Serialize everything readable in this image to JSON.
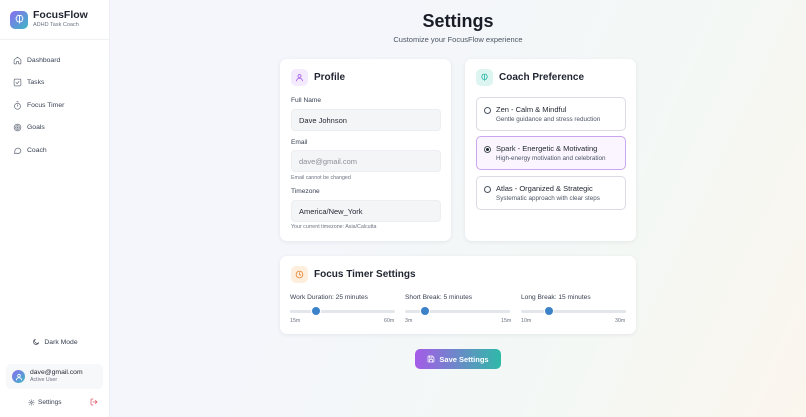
{
  "app": {
    "name": "FocusFlow",
    "tagline": "ADHD Task Coach"
  },
  "sidebar": {
    "items": [
      {
        "label": "Dashboard",
        "icon": "home-icon"
      },
      {
        "label": "Tasks",
        "icon": "check-square-icon"
      },
      {
        "label": "Focus Timer",
        "icon": "timer-icon"
      },
      {
        "label": "Goals",
        "icon": "target-icon"
      },
      {
        "label": "Coach",
        "icon": "chat-icon"
      }
    ],
    "dark_mode_label": "Dark Mode",
    "user": {
      "email": "dave@gmail.com",
      "role": "Active User"
    },
    "settings_label": "Settings"
  },
  "page": {
    "title": "Settings",
    "subtitle": "Customize your FocusFlow experience"
  },
  "profile": {
    "title": "Profile",
    "full_name_label": "Full Name",
    "full_name_value": "Dave Johnson",
    "email_label": "Email",
    "email_value": "dave@gmail.com",
    "email_hint": "Email cannot be changed",
    "timezone_label": "Timezone",
    "timezone_value": "America/New_York",
    "timezone_hint": "Your current timezone: Asia/Calcutta"
  },
  "coach": {
    "title": "Coach Preference",
    "options": [
      {
        "name": "Zen - Calm & Mindful",
        "desc": "Gentle guidance and stress reduction",
        "selected": false
      },
      {
        "name": "Spark - Energetic & Motivating",
        "desc": "High-energy motivation and celebration",
        "selected": true
      },
      {
        "name": "Atlas - Organized & Strategic",
        "desc": "Systematic approach with clear steps",
        "selected": false
      }
    ]
  },
  "timer": {
    "title": "Focus Timer Settings",
    "sliders": [
      {
        "label": "Work Duration: 25 minutes",
        "min_label": "15m",
        "max_label": "60m",
        "min": 15,
        "max": 60,
        "value": 25
      },
      {
        "label": "Short Break: 5 minutes",
        "min_label": "3m",
        "max_label": "15m",
        "min": 3,
        "max": 15,
        "value": 5
      },
      {
        "label": "Long Break: 15 minutes",
        "min_label": "10m",
        "max_label": "30m",
        "min": 10,
        "max": 30,
        "value": 15
      }
    ]
  },
  "save_label": "Save Settings",
  "colors": {
    "brand_purple": "#a55be8",
    "brand_teal": "#2fb9a8",
    "slider_thumb": "#3b82c8",
    "profile_icon_bg": "#f3ebfd",
    "coach_icon_bg": "#dcf5f0",
    "timer_icon_bg": "#fdeede"
  }
}
